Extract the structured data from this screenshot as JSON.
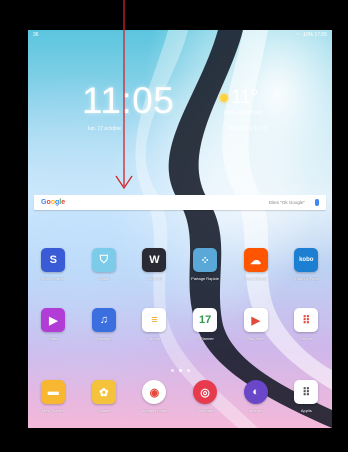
{
  "status_bar": {
    "left": "36",
    "right": "10% 17:05"
  },
  "clock": {
    "time": "11:05",
    "date": "lun. 17 octobre"
  },
  "weather": {
    "temp": "11°",
    "city": "Paris, Montchoisi",
    "updated": "Mise à jour 17:03"
  },
  "search": {
    "brand": [
      "G",
      "o",
      "o",
      "g",
      "l",
      "e"
    ],
    "hint": "Dites \"Ok Google\""
  },
  "rows": [
    [
      {
        "label": "Boite Portrait",
        "icon": "boite-portrait-icon",
        "color": "#3a5bd6",
        "glyph": "S"
      },
      {
        "label": "Avast!",
        "icon": "shield-icon",
        "color": "#7ccbe8",
        "glyph": "⛉"
      },
      {
        "label": "WinDVD",
        "icon": "windvd-icon",
        "color": "#2a2a34",
        "glyph": "W"
      },
      {
        "label": "Partage Rapide",
        "icon": "share-nodes-icon",
        "color": "#5aa8d8",
        "glyph": "⁘"
      },
      {
        "label": "SoundCloud",
        "icon": "soundcloud-icon",
        "color": "#ff5500",
        "glyph": "☁"
      },
      {
        "label": "Kobo by Fnac",
        "icon": "kobo-icon",
        "color": "#1d7fd1",
        "glyph": "kobo"
      }
    ],
    [
      {
        "label": "Vidéo",
        "icon": "play-icon",
        "color": "#b23cd6",
        "glyph": "▶"
      },
      {
        "label": "Musique",
        "icon": "music-icon",
        "color": "#3b6fe0",
        "glyph": "♫"
      },
      {
        "label": "Mémo",
        "icon": "memo-icon",
        "color": "#ffffff",
        "glyph": "≡"
      },
      {
        "label": "S Planner",
        "icon": "calendar-icon",
        "color": "#ffffff",
        "glyph": "17"
      },
      {
        "label": "Play Store",
        "icon": "play-store-icon",
        "color": "#ffffff",
        "glyph": "▶"
      },
      {
        "label": "Google",
        "icon": "google-folder-icon",
        "color": "#ffffff",
        "glyph": "⠿"
      }
    ],
    [
      {
        "label": "Mes Fichiers",
        "icon": "folder-icon",
        "color": "#f7b731",
        "glyph": "▬"
      },
      {
        "label": "Galerie",
        "icon": "gallery-icon",
        "color": "#f5c33b",
        "glyph": "✿"
      },
      {
        "label": "Appareil photo",
        "icon": "camera-icon",
        "color": "#ffffff",
        "glyph": "◉"
      },
      {
        "label": "Flipboard",
        "icon": "target-icon",
        "color": "#e73a4d",
        "glyph": "◎"
      },
      {
        "label": "Internet",
        "icon": "internet-icon",
        "color": "#6a47c9",
        "glyph": "◐"
      },
      {
        "label": "Applis",
        "icon": "apps-grid-icon",
        "color": "#ffffff",
        "glyph": "⠿"
      }
    ]
  ],
  "colors": {
    "arrow": "#d0232a"
  }
}
